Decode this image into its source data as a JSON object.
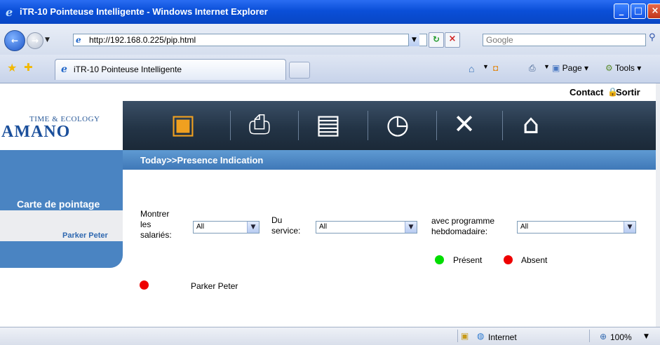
{
  "window": {
    "title": "iTR-10 Pointeuse Intelligente - Windows Internet Explorer"
  },
  "browser": {
    "url": "http://192.168.0.225/pip.html",
    "search_placeholder": "Google",
    "tab_label": "iTR-10 Pointeuse Intelligente",
    "cmd_page": "Page",
    "cmd_tools": "Tools",
    "status_zone": "Internet",
    "zoom": "100%"
  },
  "header": {
    "contact": "Contact",
    "sortir": "Sortir",
    "logo_sub": "TIME & ECOLOGY",
    "logo": "AMANO",
    "breadcrumb": "Today>>Presence Indication"
  },
  "sidebar": {
    "title": "Carte de pointage",
    "items": [
      {
        "label": "Parker Peter"
      }
    ]
  },
  "filters": {
    "employees_label": "Montrer les salariés:",
    "employees_value": "All",
    "service_label": "Du service:",
    "service_value": "All",
    "schedule_label": "avec programme hebdomadaire:",
    "schedule_value": "All"
  },
  "legend": {
    "present": "Présent",
    "absent": "Absent",
    "present_color": "#00dd00",
    "absent_color": "#ee0000"
  },
  "employees": [
    {
      "name": "Parker Peter",
      "status": "absent"
    }
  ]
}
